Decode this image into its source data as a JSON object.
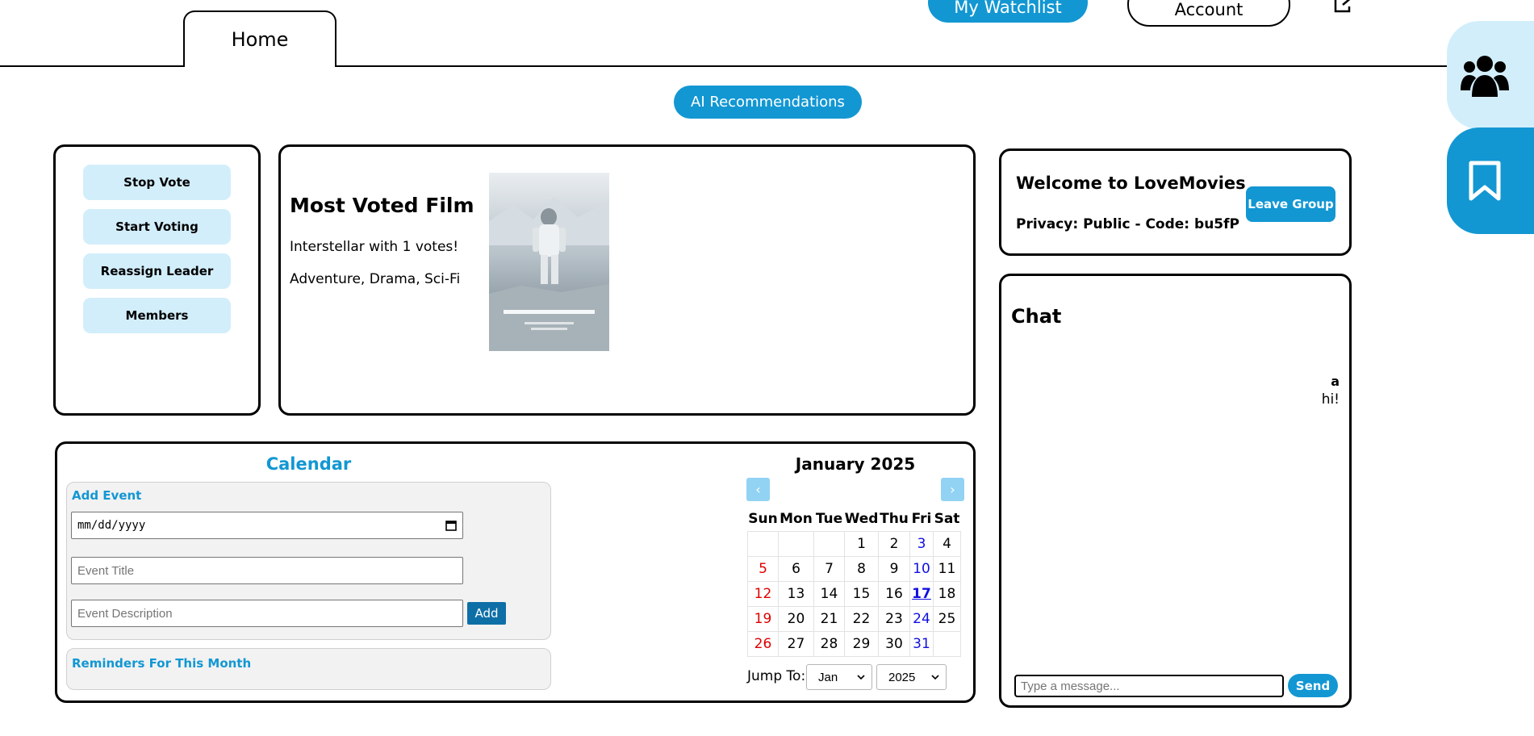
{
  "header": {
    "home_tab": "Home",
    "watchlist_button": "My Watchlist",
    "account_button": "Account",
    "ai_button": "AI Recommendations"
  },
  "sidebar_tabs": [
    "group-icon",
    "bookmark-icon"
  ],
  "vote_panel": {
    "buttons": [
      "Stop Vote",
      "Start Voting",
      "Reassign Leader",
      "Members"
    ]
  },
  "film": {
    "title": "Most Voted Film",
    "summary": "Interstellar with 1 votes!",
    "genres": "Adventure, Drama, Sci-Fi"
  },
  "group": {
    "welcome": "Welcome to LoveMovies",
    "privacy": "Privacy: Public - Code: bu5fP",
    "leave_button": "Leave Group"
  },
  "chat": {
    "title": "Chat",
    "messages": [
      {
        "user": "a",
        "text": "hi!"
      }
    ],
    "input_placeholder": "Type a message...",
    "send_button": "Send"
  },
  "calendar": {
    "title": "Calendar",
    "add_event": {
      "title": "Add Event",
      "date_placeholder": "mm/dd/yyyy",
      "event_title_placeholder": "Event Title",
      "event_description_placeholder": "Event Description",
      "add_button": "Add"
    },
    "reminders_title": "Reminders For This Month",
    "month_label": "January 2025",
    "prev": "‹",
    "next": "›",
    "weekdays": [
      "Sun",
      "Mon",
      "Tue",
      "Wed",
      "Thu",
      "Fri",
      "Sat"
    ],
    "weeks": [
      [
        "",
        "",
        "",
        "1",
        "2",
        "3",
        "4"
      ],
      [
        "5",
        "6",
        "7",
        "8",
        "9",
        "10",
        "11"
      ],
      [
        "12",
        "13",
        "14",
        "15",
        "16",
        "17",
        "18"
      ],
      [
        "19",
        "20",
        "21",
        "22",
        "23",
        "24",
        "25"
      ],
      [
        "26",
        "27",
        "28",
        "29",
        "30",
        "31",
        ""
      ]
    ],
    "today": "17",
    "jump_to_label": "Jump To:",
    "jump_month": "Jan",
    "jump_year": "2025"
  },
  "colors": {
    "accent": "#1297d3",
    "accent_light": "#d2eefb",
    "sunday": "#e00000",
    "friday": "#1010e0"
  }
}
